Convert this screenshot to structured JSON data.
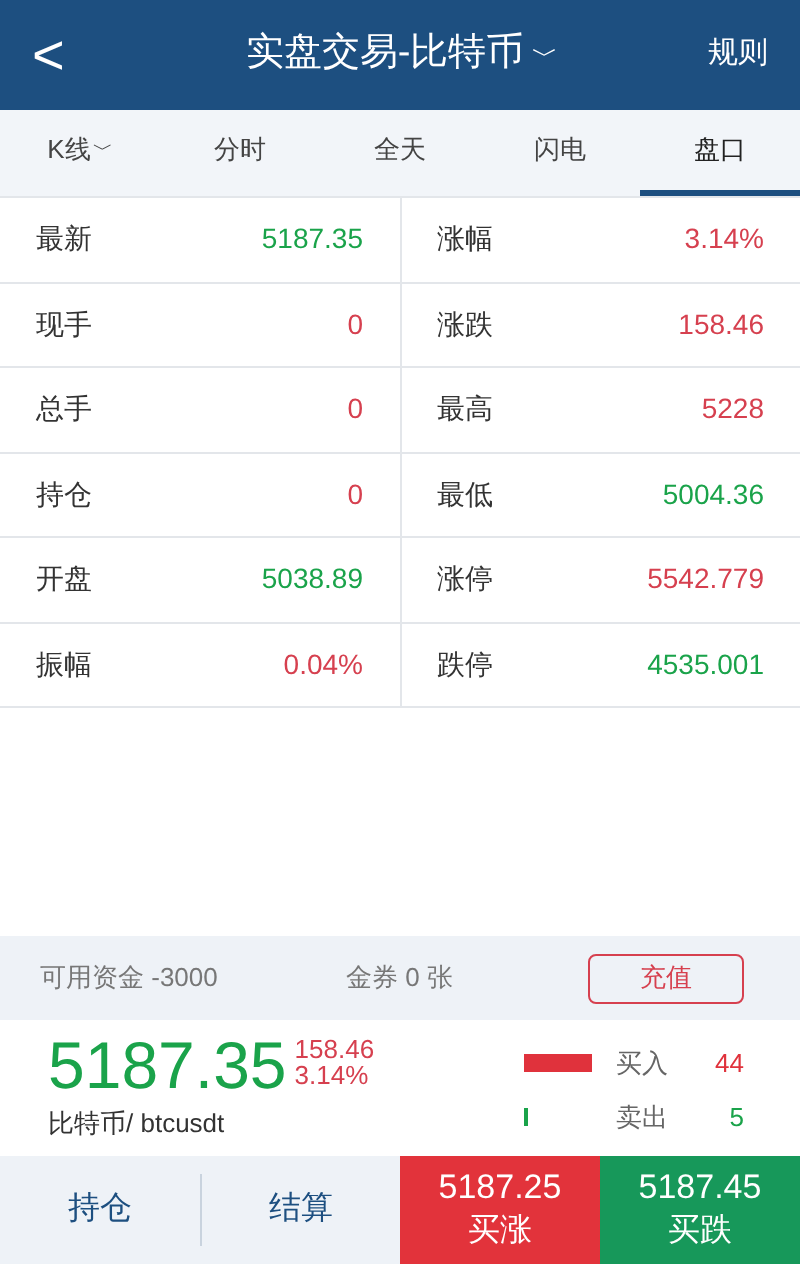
{
  "header": {
    "back": "<",
    "title": "实盘交易-比特币",
    "title_caret": "﹀",
    "rules": "规则"
  },
  "tabs": [
    {
      "label": "K线",
      "caret": "﹀",
      "selected": false
    },
    {
      "label": "分时",
      "selected": false
    },
    {
      "label": "全天",
      "selected": false
    },
    {
      "label": "闪电",
      "selected": false
    },
    {
      "label": "盘口",
      "selected": true
    }
  ],
  "quote_table": [
    [
      {
        "label": "最新",
        "value": "5187.35",
        "color": "#1aa34a"
      },
      {
        "label": "涨幅",
        "value": "3.14%",
        "color": "#d6404f"
      }
    ],
    [
      {
        "label": "现手",
        "value": "0",
        "color": "#d6404f"
      },
      {
        "label": "涨跌",
        "value": "158.46",
        "color": "#d6404f"
      }
    ],
    [
      {
        "label": "总手",
        "value": "0",
        "color": "#d6404f"
      },
      {
        "label": "最高",
        "value": "5228",
        "color": "#d6404f"
      }
    ],
    [
      {
        "label": "持仓",
        "value": "0",
        "color": "#d6404f"
      },
      {
        "label": "最低",
        "value": "5004.36",
        "color": "#1aa34a"
      }
    ],
    [
      {
        "label": "开盘",
        "value": "5038.89",
        "color": "#1aa34a"
      },
      {
        "label": "涨停",
        "value": "5542.779",
        "color": "#d6404f"
      }
    ],
    [
      {
        "label": "振幅",
        "value": "0.04%",
        "color": "#d6404f"
      },
      {
        "label": "跌停",
        "value": "4535.001",
        "color": "#1aa34a"
      }
    ]
  ],
  "funds": {
    "available": "可用资金 -3000",
    "coupons": "金券 0 张",
    "recharge": "充值"
  },
  "ticker": {
    "price": "5187.35",
    "change": "158.46",
    "change_pct": "3.14%",
    "name": "比特币/ btcusdt",
    "depth": [
      {
        "label": "买入",
        "count": "44",
        "color": "#e0323c"
      },
      {
        "label": "卖出",
        "count": "5",
        "color": "#1aa34a"
      }
    ]
  },
  "bottom_bar": {
    "tabs": [
      "持仓",
      "结算"
    ],
    "actions": [
      {
        "price": "5187.25",
        "label": "买涨",
        "color": "#e2333b"
      },
      {
        "price": "5187.45",
        "label": "买跌",
        "color": "#17985a"
      }
    ]
  }
}
